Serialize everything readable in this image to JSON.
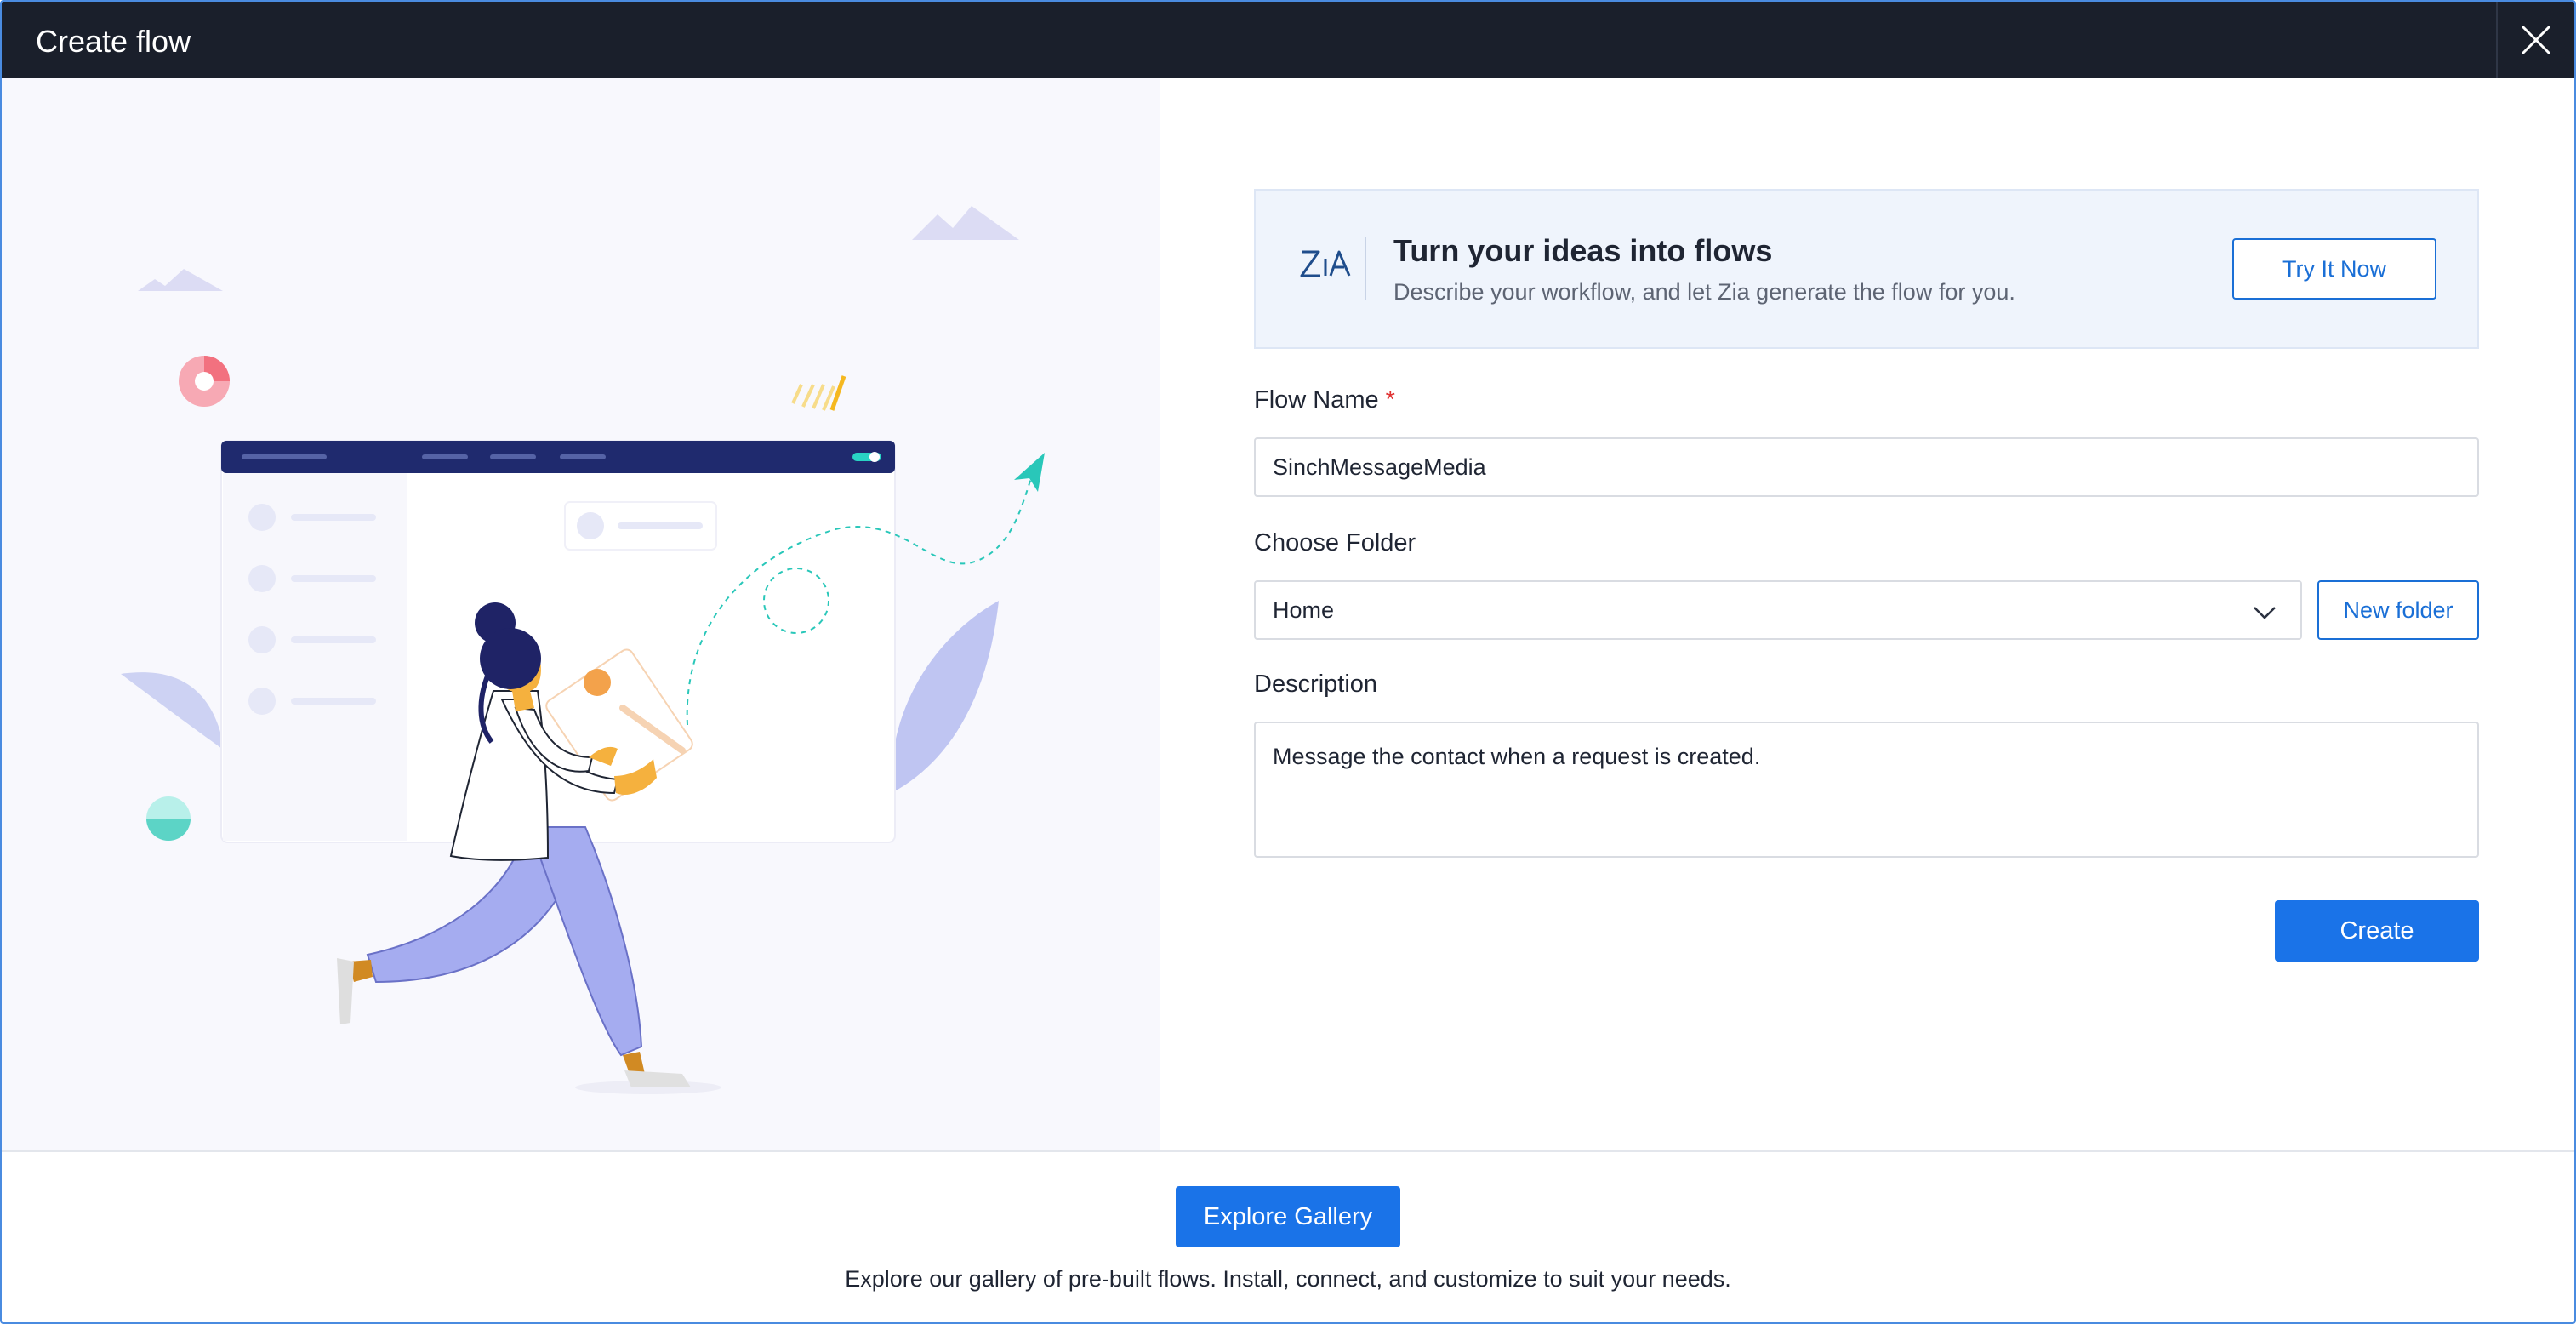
{
  "header": {
    "title": "Create flow"
  },
  "zia": {
    "title": "Turn your ideas into flows",
    "subtitle": "Describe your workflow, and let Zia generate the flow for you.",
    "button_label": "Try It Now"
  },
  "form": {
    "flow_name_label": "Flow Name",
    "required_marker": "*",
    "flow_name_value": "SinchMessageMedia",
    "folder_label": "Choose Folder",
    "folder_value": "Home",
    "new_folder_label": "New folder",
    "description_label": "Description",
    "description_value": "Message the contact when a request is created.",
    "create_label": "Create"
  },
  "footer": {
    "explore_label": "Explore Gallery",
    "text": "Explore our gallery of pre-built flows. Install, connect, and customize to suit your needs."
  },
  "icons": {
    "close": "close-icon",
    "zia": "zia-logo-icon",
    "dropdown": "chevron-down-icon"
  },
  "colors": {
    "header_bg": "#1a1f2b",
    "primary": "#1a73e8",
    "required": "#e03131"
  }
}
